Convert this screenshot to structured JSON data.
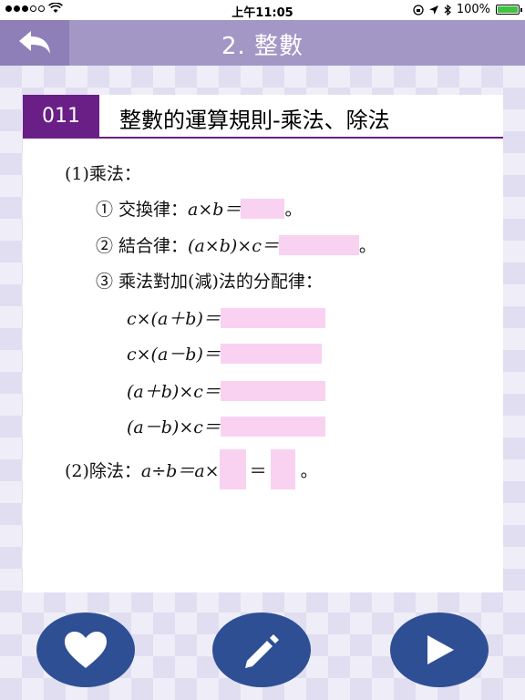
{
  "status_bar": {
    "time": "上午11:05",
    "battery": "100%",
    "battery_level": 1.0,
    "icons": [
      "signal-dots-icon",
      "wifi-icon",
      "screen-lock-icon",
      "location-icon",
      "bluetooth-icon",
      "battery-icon"
    ]
  },
  "header": {
    "title": "2. 整數",
    "back_icon": "back-arrow-icon"
  },
  "card": {
    "badge": "011",
    "title": "整數的運算規則-乘法、除法",
    "multiplication": {
      "heading": "(1)乘法：",
      "items": [
        {
          "prefix": "① 交換律：",
          "formula": "a×b＝",
          "suffix": "。"
        },
        {
          "prefix": "② 結合律：",
          "formula": "(a×b)×c＝",
          "suffix": "。"
        },
        {
          "prefix": "③ 乘法對加(減)法的分配律："
        }
      ],
      "distributive": [
        {
          "formula": "c×(a＋b)＝"
        },
        {
          "formula": "c×(a－b)＝"
        },
        {
          "formula": "(a＋b)×c＝"
        },
        {
          "formula": "(a－b)×c＝"
        }
      ]
    },
    "division": {
      "heading": "(2)除法：",
      "formula_start": "a÷b＝a×",
      "equals": "＝",
      "suffix": "。"
    }
  },
  "buttons": [
    {
      "name": "favorite",
      "icon": "heart-icon"
    },
    {
      "name": "note",
      "icon": "pencil-icon"
    },
    {
      "name": "next",
      "icon": "play-icon"
    }
  ],
  "colors": {
    "header": "#a397c6",
    "back_button": "#8e7fb8",
    "badge": "#6a1f86",
    "answer_blank": "#f9d2f1",
    "round_buttons": "#2f4f94"
  }
}
